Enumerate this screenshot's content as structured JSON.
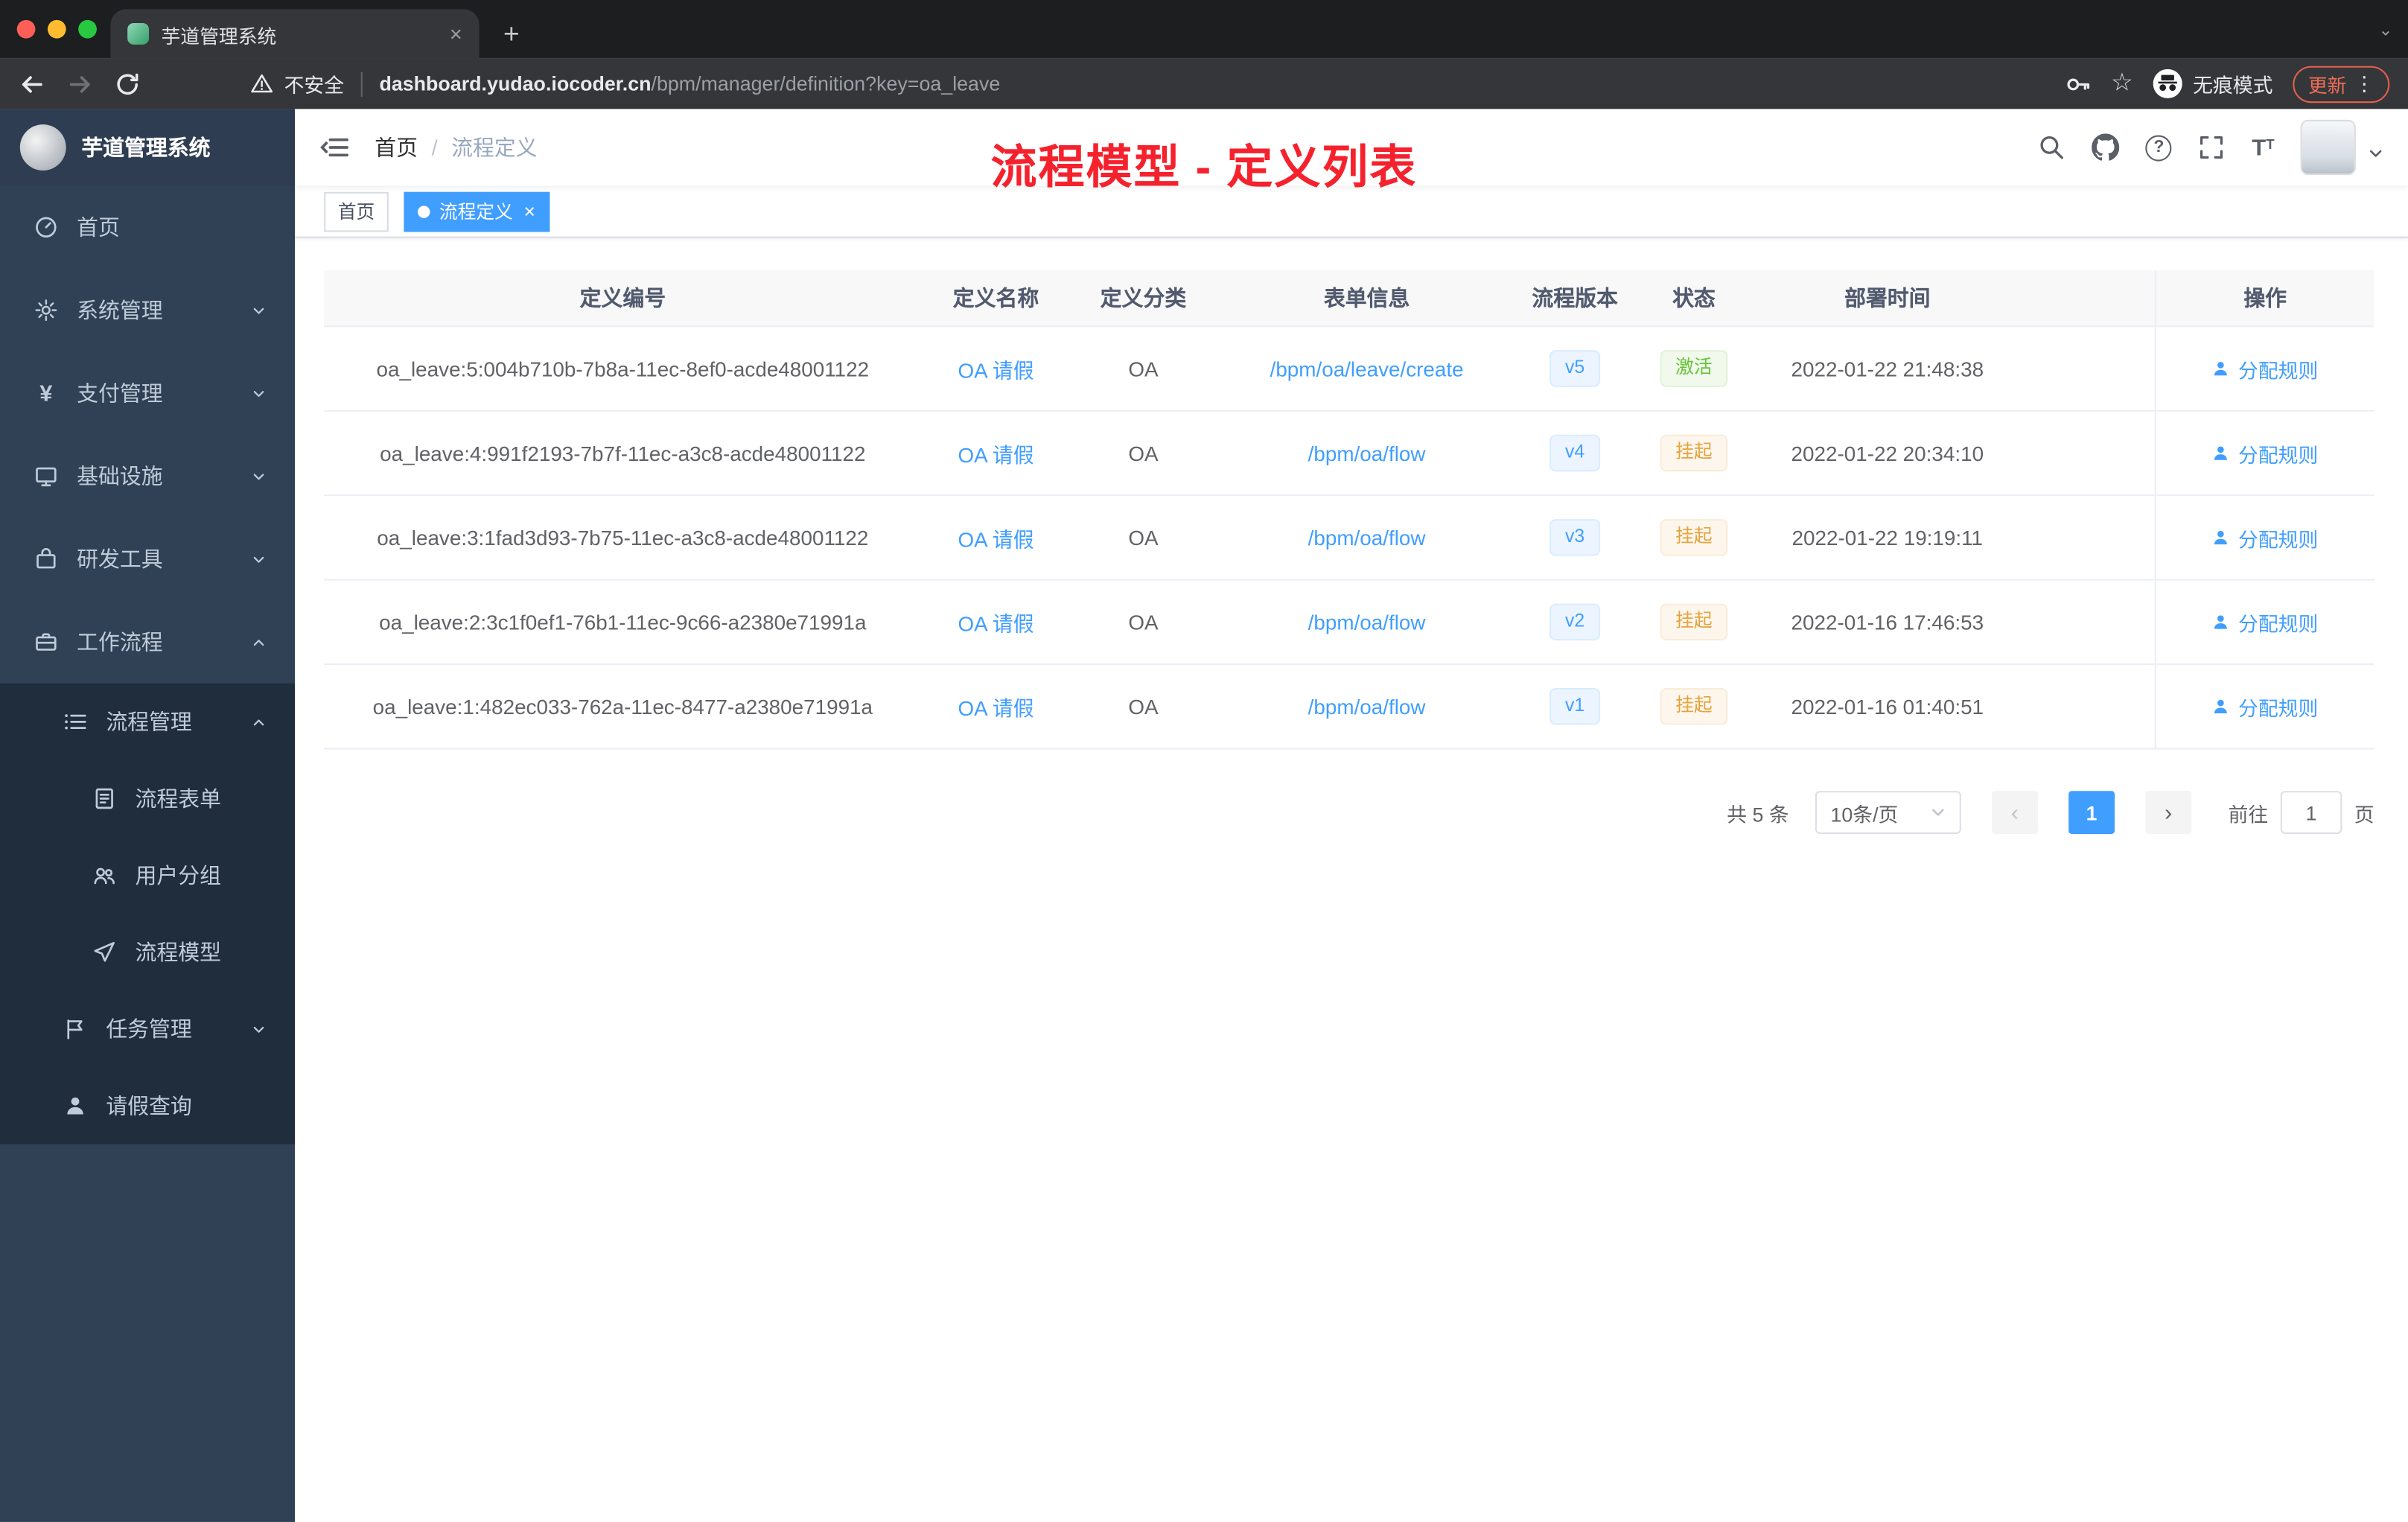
{
  "browser": {
    "tab_title": "芋道管理系统",
    "security_label": "不安全",
    "url_host": "dashboard.yudao.iocoder.cn",
    "url_path": "/bpm/manager/definition?key=oa_leave",
    "incognito_label": "无痕模式",
    "update_label": "更新"
  },
  "sidebar": {
    "app_title": "芋道管理系统",
    "items": [
      {
        "label": "首页"
      },
      {
        "label": "系统管理"
      },
      {
        "label": "支付管理"
      },
      {
        "label": "基础设施"
      },
      {
        "label": "研发工具"
      },
      {
        "label": "工作流程"
      },
      {
        "label": "流程管理"
      },
      {
        "label": "流程表单"
      },
      {
        "label": "用户分组"
      },
      {
        "label": "流程模型"
      },
      {
        "label": "任务管理"
      },
      {
        "label": "请假查询"
      }
    ]
  },
  "header": {
    "breadcrumb": {
      "home": "首页",
      "current": "流程定义"
    },
    "annotation": "流程模型 - 定义列表"
  },
  "tags": {
    "home": "首页",
    "active": "流程定义"
  },
  "table": {
    "columns": [
      "定义编号",
      "定义名称",
      "定义分类",
      "表单信息",
      "流程版本",
      "状态",
      "部署时间",
      "操作"
    ],
    "rows": [
      {
        "id": "oa_leave:5:004b710b-7b8a-11ec-8ef0-acde48001122",
        "name": "OA 请假",
        "category": "OA",
        "form": "/bpm/oa/leave/create",
        "version": "v5",
        "status": "激活",
        "status_type": "success",
        "time": "2022-01-22 21:48:38",
        "action": "分配规则"
      },
      {
        "id": "oa_leave:4:991f2193-7b7f-11ec-a3c8-acde48001122",
        "name": "OA 请假",
        "category": "OA",
        "form": "/bpm/oa/flow",
        "version": "v4",
        "status": "挂起",
        "status_type": "warning",
        "time": "2022-01-22 20:34:10",
        "action": "分配规则"
      },
      {
        "id": "oa_leave:3:1fad3d93-7b75-11ec-a3c8-acde48001122",
        "name": "OA 请假",
        "category": "OA",
        "form": "/bpm/oa/flow",
        "version": "v3",
        "status": "挂起",
        "status_type": "warning",
        "time": "2022-01-22 19:19:11",
        "action": "分配规则"
      },
      {
        "id": "oa_leave:2:3c1f0ef1-76b1-11ec-9c66-a2380e71991a",
        "name": "OA 请假",
        "category": "OA",
        "form": "/bpm/oa/flow",
        "version": "v2",
        "status": "挂起",
        "status_type": "warning",
        "time": "2022-01-16 17:46:53",
        "action": "分配规则"
      },
      {
        "id": "oa_leave:1:482ec033-762a-11ec-8477-a2380e71991a",
        "name": "OA 请假",
        "category": "OA",
        "form": "/bpm/oa/flow",
        "version": "v1",
        "status": "挂起",
        "status_type": "warning",
        "time": "2022-01-16 01:40:51",
        "action": "分配规则"
      }
    ]
  },
  "pagination": {
    "total": "共 5 条",
    "page_size": "10条/页",
    "page": "1",
    "goto_prefix": "前往",
    "goto_value": "1",
    "goto_suffix": "页"
  },
  "colors": {
    "accent": "#409eff",
    "success": "#67c23a",
    "warning": "#e6a23c",
    "annotation_red": "#f5222d",
    "sidebar_bg": "#304156",
    "submenu_bg": "#1f2d3d"
  }
}
